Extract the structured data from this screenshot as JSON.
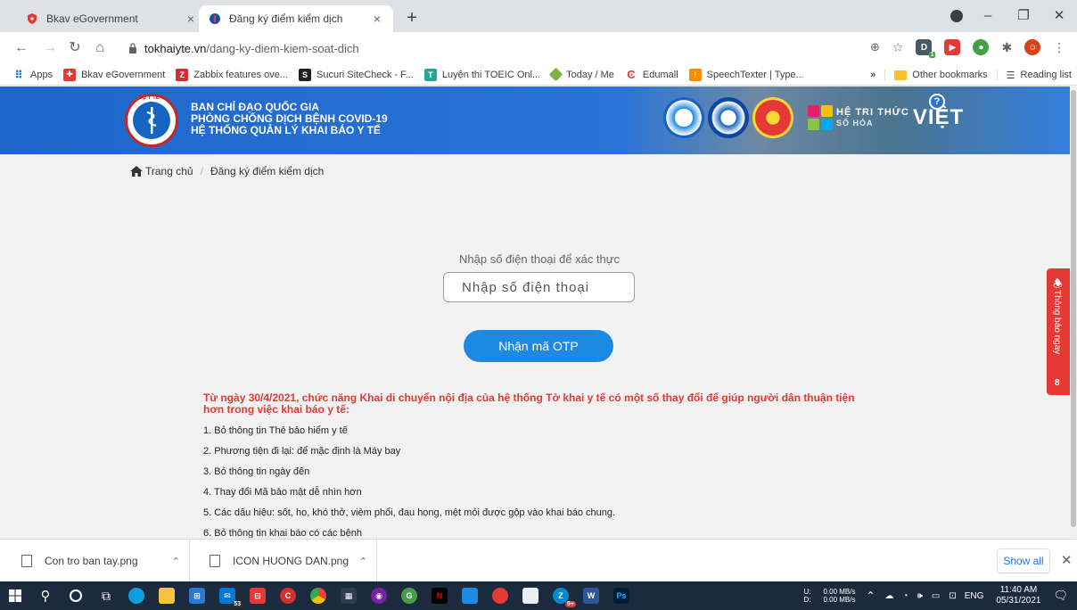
{
  "browser": {
    "tabs": [
      {
        "title": "Bkav eGovernment",
        "active": false
      },
      {
        "title": "Đăng ký điểm kiểm dịch",
        "active": true
      }
    ],
    "new_tab_symbol": "+",
    "address": {
      "domain": "tokhaiyte.vn",
      "path": "/dang-ky-diem-kiem-soat-dich"
    },
    "bookmarks": [
      {
        "label": "Apps",
        "icon": "apps-grid-icon",
        "color": "#1a73e8"
      },
      {
        "label": "Bkav eGovernment",
        "icon": "bkav-icon",
        "color": "#e53935"
      },
      {
        "label": "Zabbix features ove...",
        "icon": "zabbix-icon",
        "color": "#d32f2f"
      },
      {
        "label": "Sucuri SiteCheck - F...",
        "icon": "sucuri-icon",
        "color": "#222222"
      },
      {
        "label": "Luyện thi TOEIC Onl...",
        "icon": "toeic-icon",
        "color": "#43a047"
      },
      {
        "label": "Today / Me",
        "icon": "today-icon",
        "color": "#7cb342"
      },
      {
        "label": "Edumall",
        "icon": "edumall-icon",
        "color": "#e53935"
      },
      {
        "label": "SpeechTexter | Type...",
        "icon": "speechtexter-icon",
        "color": "#fb8c00"
      }
    ],
    "bookmarks_overflow": "»",
    "other_bookmarks": "Other bookmarks",
    "reading_list": "Reading list",
    "extension_badge": "1"
  },
  "page": {
    "banner": {
      "line1": "BAN CHỈ ĐẠO QUỐC GIA",
      "line2": "PHÒNG CHỐNG DỊCH BỆNH COVID-19",
      "line3": "HỆ THỐNG QUẢN LÝ KHAI BÁO Y TẾ",
      "logo_text": "BỘ Y TẾ",
      "brand_top": "HỆ TRI THỨC",
      "brand_sub": "SỐ HÓA",
      "brand_main": "VIỆT",
      "help_symbol": "?"
    },
    "breadcrumb": {
      "home": "Trang chủ",
      "separator": "/",
      "current": "Đăng ký điểm kiểm dịch"
    },
    "verify_label": "Nhập số điện thoại để xác thực",
    "phone_placeholder": "Nhập số điện thoại",
    "otp_button": "Nhận mã OTP",
    "notice": {
      "headline": "Từ ngày 30/4/2021, chức năng Khai di chuyển nội địa của hệ thống Tờ khai y tế có một số thay đổi để giúp người dân thuận tiện hơn trong việc khai báo y tế:",
      "items": [
        "1. Bỏ thông tin Thẻ bảo hiểm y tế",
        "2. Phương tiện đi lại: để mặc định là Máy bay",
        "3. Bỏ thông tin ngày đến",
        "4. Thay đổi Mã bảo mật dễ nhìn hơn",
        "5. Các dấu hiệu: sốt, ho, khó thở, viêm phổi, đau họng, mệt mỏi được gộp vào khai báo chung.",
        "6. Bỏ thông tin khai báo có các bệnh"
      ]
    },
    "side_tab": {
      "label": "Thông báo ngay",
      "count": "8"
    }
  },
  "downloads": {
    "items": [
      "Con tro ban tay.png",
      "ICON HUONG DAN.png"
    ],
    "show_all": "Show all"
  },
  "taskbar": {
    "badge_mail": "53",
    "badge_zalo": "5+",
    "network": {
      "up_label": "U:",
      "down_label": "D:",
      "up": "0.00 MB/s",
      "down": "0.00 MB/s"
    },
    "language": "ENG",
    "time": "11:40 AM",
    "date": "05/31/2021"
  },
  "colors": {
    "banner_blue": "#2a73d6",
    "accent_blue": "#1e88e5",
    "alert_red": "#e53935"
  }
}
